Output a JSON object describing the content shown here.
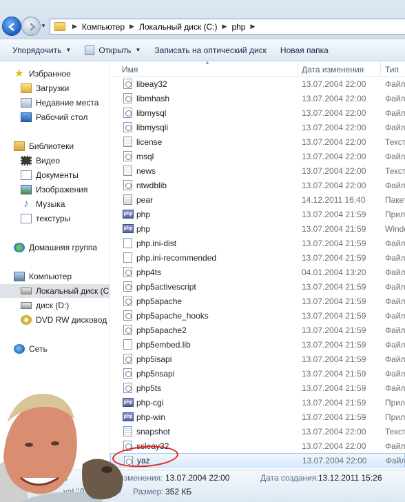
{
  "address": {
    "crumbs": [
      "Компьютер",
      "Локальный диск (C:)",
      "php"
    ]
  },
  "toolbar": {
    "organize_label": "Упорядочить",
    "open_label": "Открыть",
    "burn_label": "Записать на оптический диск",
    "new_folder_label": "Новая папка"
  },
  "nav": {
    "favorites": "Избранное",
    "downloads": "Загрузки",
    "recent": "Недавние места",
    "desktop": "Рабочий стол",
    "libraries": "Библиотеки",
    "video": "Видео",
    "documents": "Документы",
    "images": "Изображения",
    "music": "Музыка",
    "textures": "текстуры",
    "homegroup": "Домашняя группа",
    "computer": "Компьютер",
    "local_disk": "Локальный диск (C",
    "disk_d": "диск (D:)",
    "dvd": "DVD RW дисковод (",
    "network": "Сеть"
  },
  "columns": {
    "name": "Имя",
    "date": "Дата изменения",
    "type": "Тип"
  },
  "files": [
    {
      "name": "libeay32",
      "date": "13.07.2004 22:00",
      "type": "Файл",
      "icon": "dll-icon"
    },
    {
      "name": "libmhash",
      "date": "13.07.2004 22:00",
      "type": "Файл",
      "icon": "dll-icon"
    },
    {
      "name": "libmysql",
      "date": "13.07.2004 22:00",
      "type": "Файл",
      "icon": "dll-icon"
    },
    {
      "name": "libmysqli",
      "date": "13.07.2004 22:00",
      "type": "Файл",
      "icon": "dll-icon"
    },
    {
      "name": "license",
      "date": "13.07.2004 22:00",
      "type": "Текст",
      "icon": "text-file-icon"
    },
    {
      "name": "msql",
      "date": "13.07.2004 22:00",
      "type": "Файл",
      "icon": "dll-icon"
    },
    {
      "name": "news",
      "date": "13.07.2004 22:00",
      "type": "Текст",
      "icon": "text-file-icon"
    },
    {
      "name": "ntwdblib",
      "date": "13.07.2004 22:00",
      "type": "Файл",
      "icon": "dll-icon"
    },
    {
      "name": "pear",
      "date": "14.12.2011 16:40",
      "type": "Пакет",
      "icon": "batch-file-icon"
    },
    {
      "name": "php",
      "date": "13.07.2004 21:59",
      "type": "Прил",
      "icon": "php-icon"
    },
    {
      "name": "php",
      "date": "13.07.2004 21:59",
      "type": "Windo",
      "icon": "php-icon"
    },
    {
      "name": "php.ini-dist",
      "date": "13.07.2004 21:59",
      "type": "Файл",
      "icon": "file-icon"
    },
    {
      "name": "php.ini-recommended",
      "date": "13.07.2004 21:59",
      "type": "Файл",
      "icon": "file-icon"
    },
    {
      "name": "php4ts",
      "date": "04.01.2004 13:20",
      "type": "Файл",
      "icon": "dll-icon"
    },
    {
      "name": "php5activescript",
      "date": "13.07.2004 21:59",
      "type": "Файл",
      "icon": "dll-icon"
    },
    {
      "name": "php5apache",
      "date": "13.07.2004 21:59",
      "type": "Файл",
      "icon": "dll-icon"
    },
    {
      "name": "php5apache_hooks",
      "date": "13.07.2004 21:59",
      "type": "Файл",
      "icon": "dll-icon"
    },
    {
      "name": "php5apache2",
      "date": "13.07.2004 21:59",
      "type": "Файл",
      "icon": "dll-icon"
    },
    {
      "name": "php5embed.lib",
      "date": "13.07.2004 21:59",
      "type": "Файл",
      "icon": "file-icon"
    },
    {
      "name": "php5isapi",
      "date": "13.07.2004 21:59",
      "type": "Файл",
      "icon": "dll-icon"
    },
    {
      "name": "php5nsapi",
      "date": "13.07.2004 21:59",
      "type": "Файл",
      "icon": "dll-icon"
    },
    {
      "name": "php5ts",
      "date": "13.07.2004 21:59",
      "type": "Файл",
      "icon": "dll-icon"
    },
    {
      "name": "php-cgi",
      "date": "13.07.2004 21:59",
      "type": "Прил",
      "icon": "php-icon"
    },
    {
      "name": "php-win",
      "date": "13.07.2004 21:59",
      "type": "Прил",
      "icon": "php-icon"
    },
    {
      "name": "snapshot",
      "date": "13.07.2004 22:00",
      "type": "Текст",
      "icon": "text-file-icon"
    },
    {
      "name": "ssleay32",
      "date": "13.07.2004 22:00",
      "type": "Файл",
      "icon": "dll-icon"
    },
    {
      "name": "yaz",
      "date": "13.07.2004 22:00",
      "type": "Файл",
      "icon": "dll-icon",
      "selected": true
    }
  ],
  "details": {
    "partial_left": "с",
    "partial_left2": "уаl \"Д",
    "modified_label": "Дата изменения:",
    "modified_value": "13.07.2004 22:00",
    "created_label": "Дата создания:",
    "created_value": "13.12.2011 15:26",
    "size_label": "Размер:",
    "size_value": "352 КБ"
  },
  "colors": {
    "highlight_ellipse": "#e2231a",
    "selection": "#d9e9fb"
  }
}
